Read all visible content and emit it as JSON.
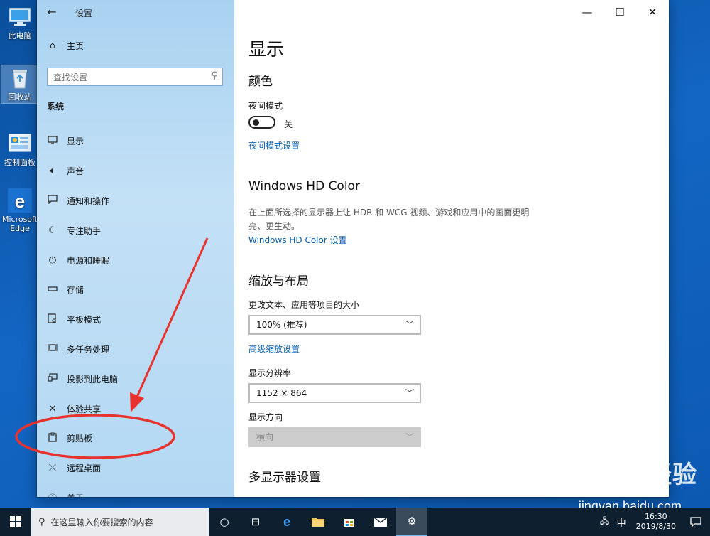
{
  "desktop": {
    "icons": [
      {
        "label": "此电脑",
        "icon": "this-pc-icon"
      },
      {
        "label": "回收站",
        "icon": "recycle-bin-icon"
      },
      {
        "label": "控制面板",
        "icon": "control-panel-icon"
      },
      {
        "label": "Microsoft Edge",
        "icon": "edge-icon"
      }
    ]
  },
  "window": {
    "title": "设置",
    "controls": {
      "minimize": "—",
      "maximize": "☐",
      "close": "✕"
    }
  },
  "sidebar": {
    "home_label": "主页",
    "search_placeholder": "查找设置",
    "section": "系统",
    "items": [
      {
        "label": "显示",
        "icon": "monitor-icon"
      },
      {
        "label": "声音",
        "icon": "speaker-icon"
      },
      {
        "label": "通知和操作",
        "icon": "notification-icon"
      },
      {
        "label": "专注助手",
        "icon": "moon-icon"
      },
      {
        "label": "电源和睡眠",
        "icon": "power-icon"
      },
      {
        "label": "存储",
        "icon": "storage-icon"
      },
      {
        "label": "平板模式",
        "icon": "tablet-icon"
      },
      {
        "label": "多任务处理",
        "icon": "multitask-icon"
      },
      {
        "label": "投影到此电脑",
        "icon": "project-icon"
      },
      {
        "label": "体验共享",
        "icon": "share-icon"
      },
      {
        "label": "剪贴板",
        "icon": "clipboard-icon"
      },
      {
        "label": "远程桌面",
        "icon": "remote-desktop-icon"
      },
      {
        "label": "关于",
        "icon": "info-icon"
      }
    ]
  },
  "content": {
    "title": "显示",
    "color_section": "颜色",
    "night_light_label": "夜间模式",
    "night_light_state": "关",
    "night_light_on": false,
    "night_light_link": "夜间模式设置",
    "hdr_section": "Windows HD Color",
    "hdr_desc": "在上面所选择的显示器上让 HDR 和 WCG 视频、游戏和应用中的画面更明亮、更生动。",
    "hdr_link": "Windows HD Color 设置",
    "scale_section": "缩放与布局",
    "scale_label": "更改文本、应用等项目的大小",
    "scale_value": "100% (推荐)",
    "scale_link": "高级缩放设置",
    "resolution_label": "显示分辨率",
    "resolution_value": "1152 × 864",
    "orientation_label": "显示方向",
    "orientation_value": "横向",
    "multi_display_section": "多显示器设置"
  },
  "taskbar": {
    "search_placeholder": "在这里输入你要搜索的内容",
    "time": "16:30",
    "date": "2019/8/30",
    "ime": "中"
  },
  "watermark": {
    "brand": "Baidu 经验",
    "url": "jingyan.baidu.com"
  },
  "colors": {
    "link": "#0a62b8",
    "sidebar_bg": "#b4d8f3",
    "desktop_bg": "#1366c4",
    "annotation": "#e8322d",
    "taskbar": "#0e1f2f"
  }
}
